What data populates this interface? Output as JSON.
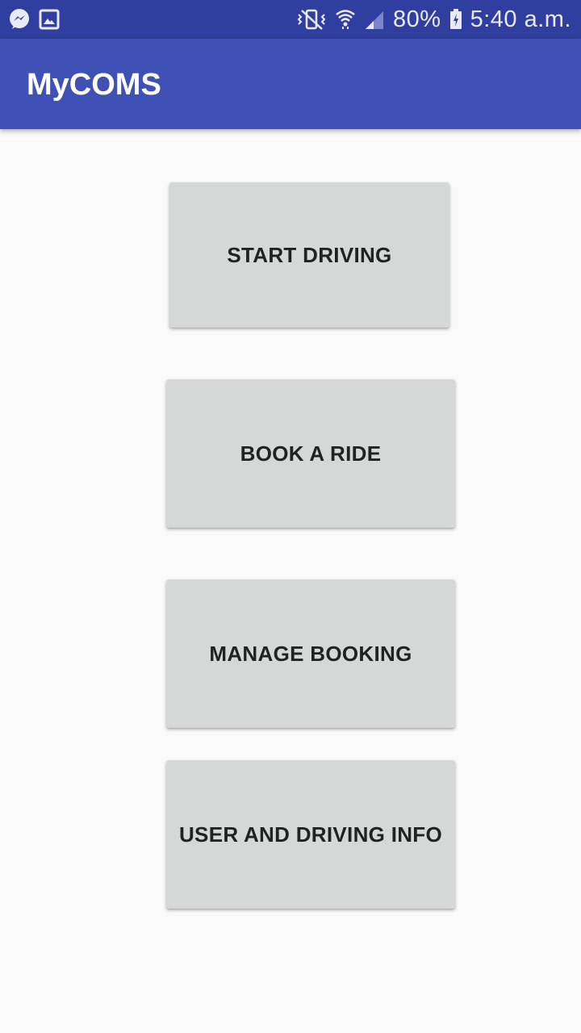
{
  "status_bar": {
    "left_icons": [
      "messenger-icon",
      "gallery-icon"
    ],
    "right_icons": [
      "vibrate-mute-icon",
      "wifi-icon",
      "signal-icon",
      "battery-charging-icon"
    ],
    "battery": "80%",
    "time": "5:40 a.m."
  },
  "app_bar": {
    "title": "MyCOMS"
  },
  "buttons": [
    {
      "label": "START DRIVING"
    },
    {
      "label": "BOOK A RIDE"
    },
    {
      "label": "MANAGE BOOKING"
    },
    {
      "label": "USER AND DRIVING INFO"
    }
  ],
  "colors": {
    "status_bar": "#303f9f",
    "app_bar": "#3f51b5",
    "background": "#fafafa",
    "button": "#d6d7d7",
    "button_text": "#222222"
  }
}
